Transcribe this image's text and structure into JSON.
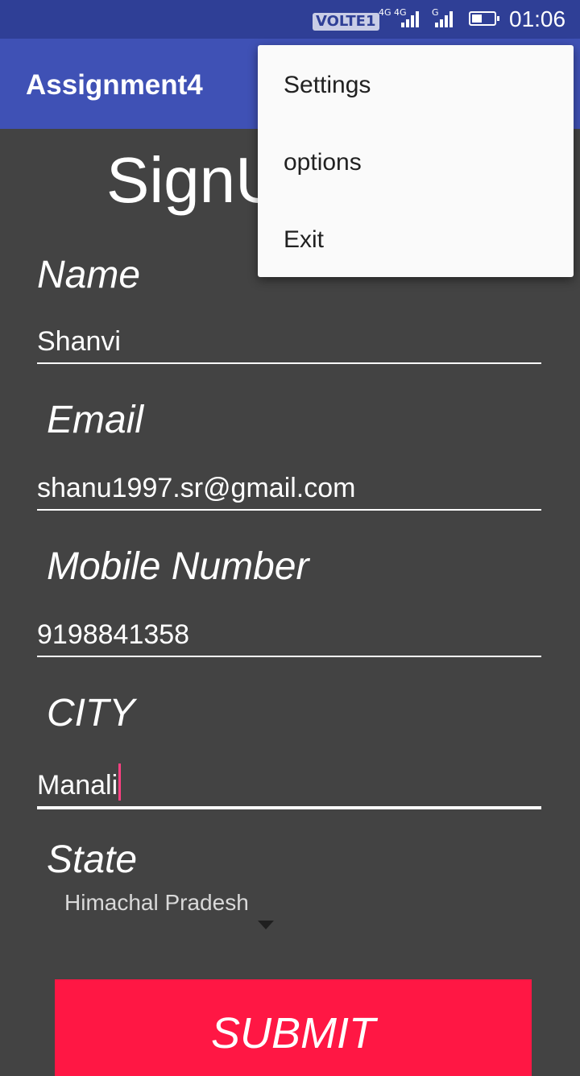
{
  "status_bar": {
    "carrier_badge": "VOLTE1",
    "net1": "4G",
    "net2": "4G",
    "net3": "G",
    "time": "01:06"
  },
  "app_bar": {
    "title": "Assignment4"
  },
  "form": {
    "heading": "SignUp",
    "name_label": "Name",
    "name_value": "Shanvi",
    "email_label": "Email",
    "email_value": "shanu1997.sr@gmail.com",
    "mobile_label": "Mobile Number",
    "mobile_value": "9198841358",
    "city_label": "CITY",
    "city_value": "Manali",
    "state_label": "State",
    "state_value": "Himachal Pradesh",
    "submit_label": "SUBMIT"
  },
  "overflow_menu": {
    "items": [
      {
        "label": "Settings"
      },
      {
        "label": "options"
      },
      {
        "label": "Exit"
      }
    ]
  },
  "colors": {
    "status_bar": "#2f3f96",
    "app_bar": "#3f51b5",
    "background": "#434343",
    "submit": "#ff1744",
    "caret": "#ff4081",
    "menu": "#fafafa"
  }
}
